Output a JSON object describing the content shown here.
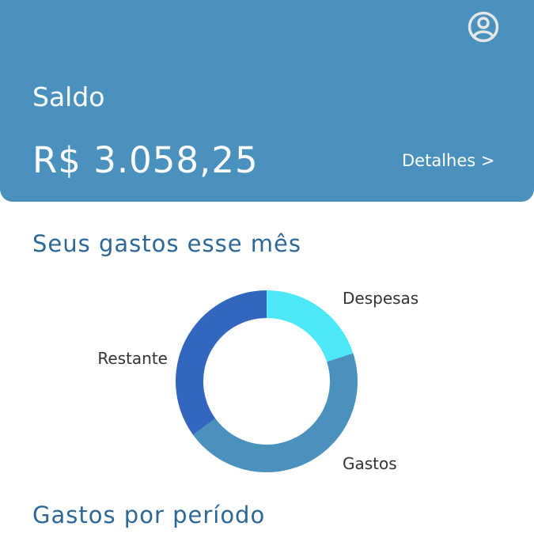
{
  "header": {
    "balance_label": "Saldo",
    "balance_value": "R$ 3.058,25",
    "details_link": "Detalhes >",
    "profile_icon": "account-circle-icon",
    "background_color": "#4a92bd"
  },
  "sections": {
    "monthly_title": "Seus gastos esse mês",
    "period_title": "Gastos por período"
  },
  "chart_data": {
    "type": "pie",
    "style": "donut",
    "categories": [
      "Despesas",
      "Gastos",
      "Restante"
    ],
    "values": [
      20,
      45,
      35
    ],
    "colors": [
      "#4ce8f8",
      "#4a92bd",
      "#3367bf"
    ]
  }
}
